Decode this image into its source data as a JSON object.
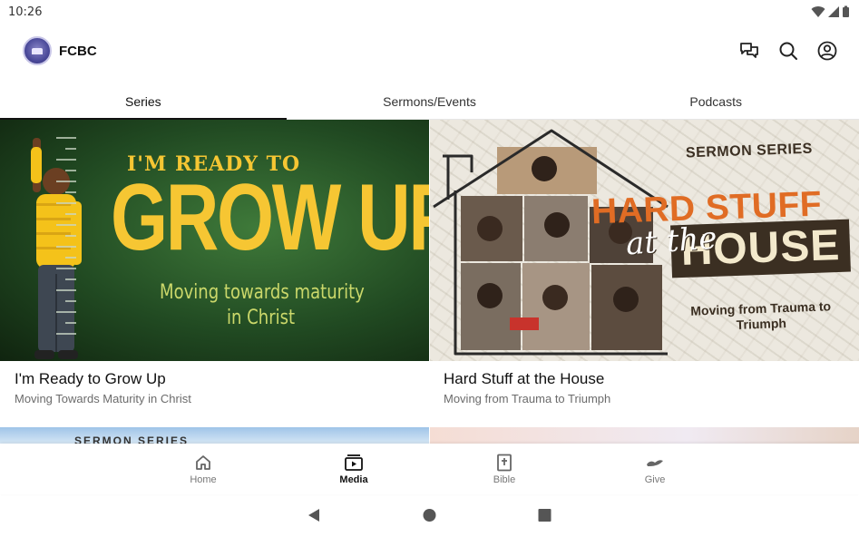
{
  "status": {
    "time": "10:26"
  },
  "header": {
    "app_name": "FCBC"
  },
  "tabs": [
    {
      "label": "Series",
      "active": true
    },
    {
      "label": "Sermons/Events",
      "active": false
    },
    {
      "label": "Podcasts",
      "active": false
    }
  ],
  "cards": [
    {
      "title": "I'm Ready to Grow Up",
      "subtitle": "Moving Towards Maturity in Christ",
      "art": {
        "line1": "I'M READY TO",
        "line2": "GROW UP!",
        "line3": "Moving towards maturity",
        "line4": "in Christ"
      }
    },
    {
      "title": "Hard Stuff at the House",
      "subtitle": "Moving from Trauma to Triumph",
      "art": {
        "series_label": "SERMON SERIES",
        "hard_stuff": "HARD STUFF",
        "at_the": "at the",
        "house": "HOUSE",
        "tagline": "Moving from Trauma to Triumph"
      }
    }
  ],
  "partial_row": {
    "left_label": "SERMON SERIES"
  },
  "bottom_nav": [
    {
      "label": "Home",
      "icon": "home-icon",
      "active": false
    },
    {
      "label": "Media",
      "icon": "media-icon",
      "active": true
    },
    {
      "label": "Bible",
      "icon": "bible-icon",
      "active": false
    },
    {
      "label": "Give",
      "icon": "give-icon",
      "active": false
    }
  ],
  "colors": {
    "grow_yellow": "#f6c633",
    "grow_green": "#214a22",
    "hard_orange": "#e06c24",
    "hard_brown": "#3b2f22"
  }
}
